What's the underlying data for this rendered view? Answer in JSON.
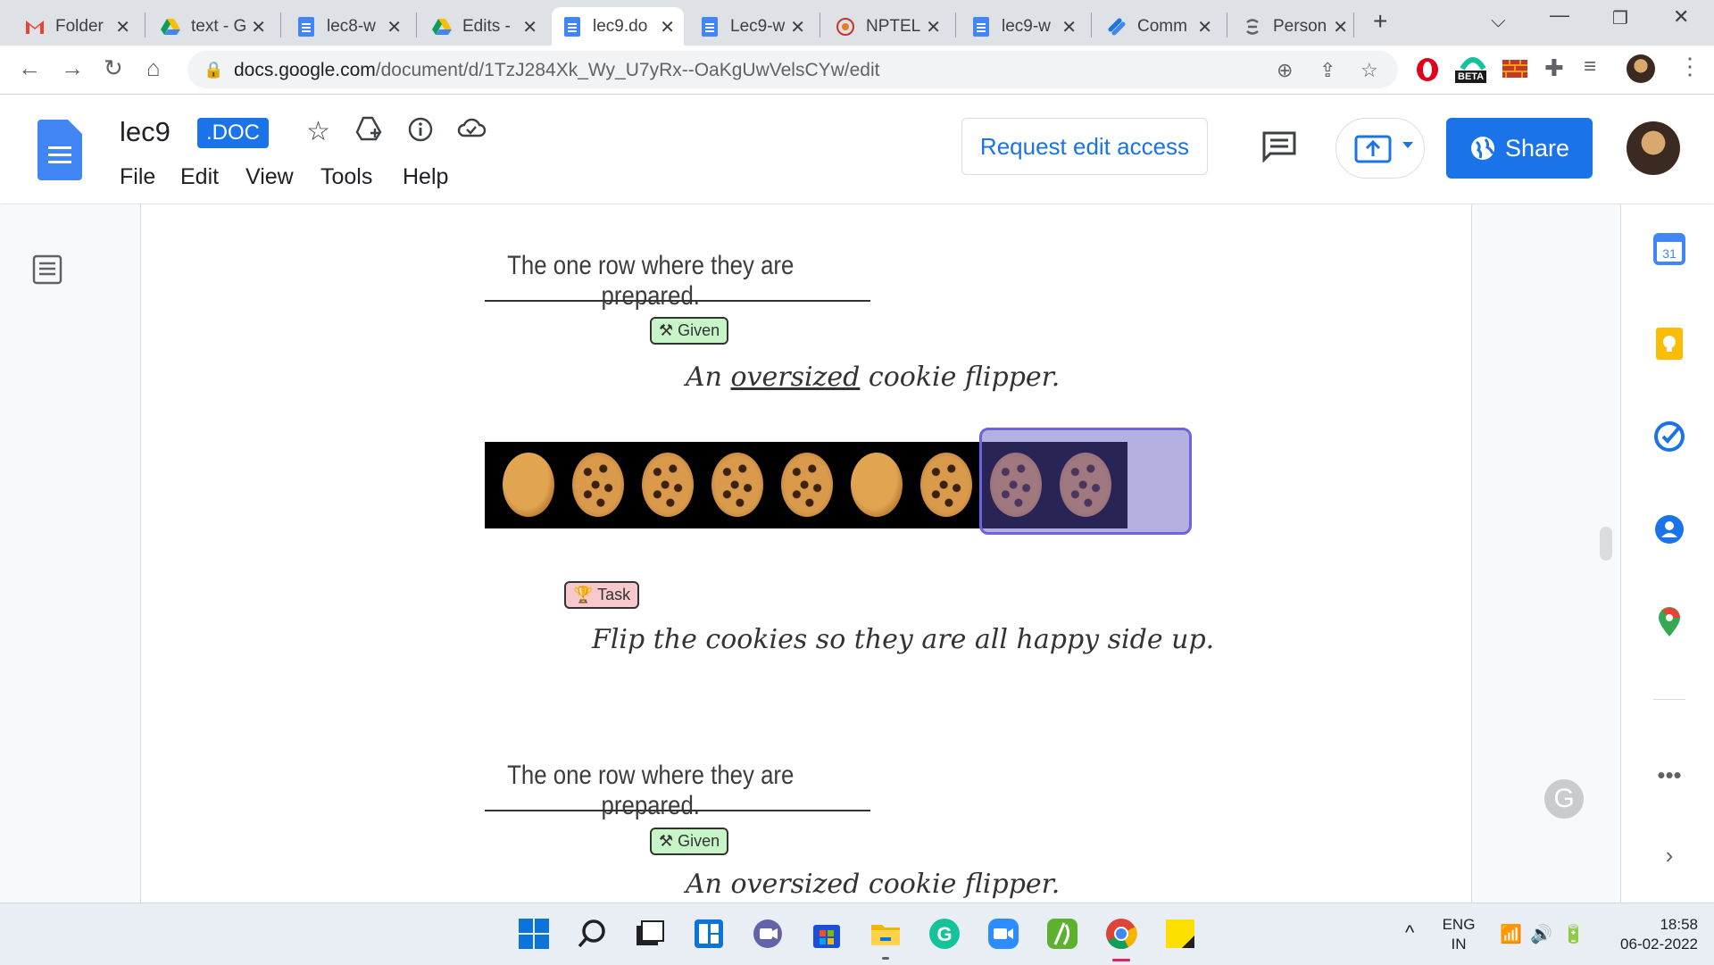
{
  "browser": {
    "tabs": [
      {
        "label": "Folder",
        "icon": "gmail-icon"
      },
      {
        "label": "text - G",
        "icon": "drive-icon"
      },
      {
        "label": "lec8-w",
        "icon": "docs-icon"
      },
      {
        "label": "Edits -",
        "icon": "drive-icon"
      },
      {
        "label": "lec9.do",
        "icon": "docs-icon",
        "active": true
      },
      {
        "label": "Lec9-w",
        "icon": "docs-icon"
      },
      {
        "label": "NPTEL",
        "icon": "nptel-icon"
      },
      {
        "label": "lec9-w",
        "icon": "docs-icon"
      },
      {
        "label": "Comm",
        "icon": "link-icon"
      },
      {
        "label": "Person",
        "icon": "link-icon"
      }
    ],
    "url_host": "docs.google.com",
    "url_path": "/document/d/1TzJ284Xk_Wy_U7yRx--OaKgUwVelsCYw/edit",
    "beta_badge": "BETA"
  },
  "doc": {
    "title": "lec9",
    "badge": ".DOC",
    "menu": [
      "File",
      "Edit",
      "View",
      "Tools",
      "Help"
    ],
    "request_edit": "Request edit access",
    "share": "Share"
  },
  "content": {
    "heading1": "The one row where they are prepared.",
    "given_tag": "Given",
    "given_text_pre": "An ",
    "given_text_underlined": "oversized",
    "given_text_post": " cookie flipper.",
    "cookies": [
      "plain",
      "chip",
      "chip",
      "chip",
      "chip",
      "plain",
      "chip",
      "chip",
      "chip"
    ],
    "task_tag": "Task",
    "task_text": "Flip the cookies so they are all happy side up.",
    "heading2": "The one row where they are prepared.",
    "given_tag2": "Given",
    "given_text2": "An oversized cookie flipper."
  },
  "taskbar": {
    "lang_top": "ENG",
    "lang_bottom": "IN",
    "time": "18:58",
    "date": "06-02-2022"
  },
  "colors": {
    "accent": "#1a73e8",
    "selection": "#6c63e0",
    "given_bg": "#c8f5c8",
    "task_bg": "#f6c9cc"
  }
}
